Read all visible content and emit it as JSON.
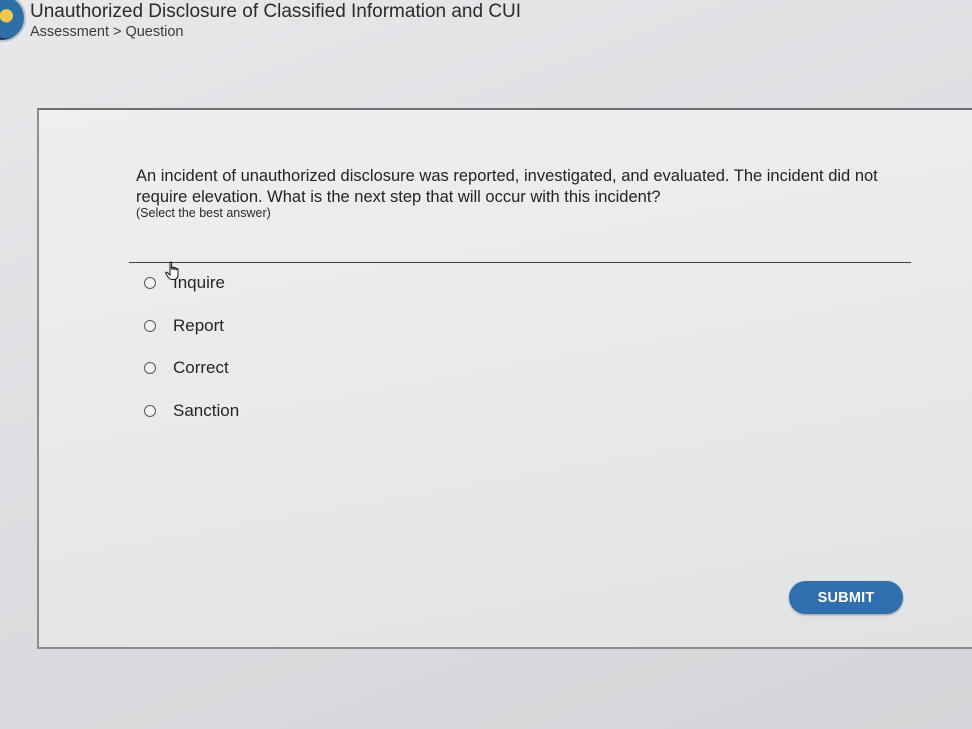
{
  "header": {
    "course_title": "Unauthorized Disclosure of Classified Information and CUI",
    "breadcrumb": [
      "Assessment",
      "Question"
    ],
    "breadcrumb_separator": ">"
  },
  "question": {
    "text": "An incident of unauthorized disclosure was reported, investigated, and evaluated. The incident did not require elevation. What is the next step that will occur with this incident?",
    "instruction": "(Select the best answer)",
    "options": [
      {
        "label": "Inquire",
        "selected": false
      },
      {
        "label": "Report",
        "selected": false
      },
      {
        "label": "Correct",
        "selected": false
      },
      {
        "label": "Sanction",
        "selected": false
      }
    ]
  },
  "actions": {
    "submit_label": "SUBMIT"
  },
  "colors": {
    "submit_button": "#2f6fb0",
    "background": "#dfe1e3"
  },
  "icons": {
    "logo": "seal-logo-icon",
    "cursor": "hand-pointer-icon"
  }
}
